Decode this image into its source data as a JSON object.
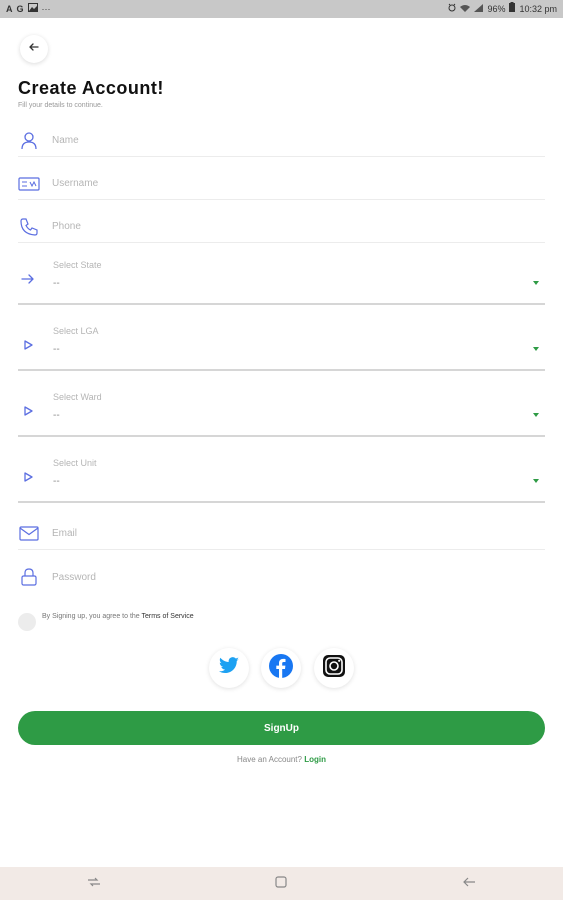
{
  "status_bar": {
    "left_icons": [
      "A",
      "G"
    ],
    "dots": "···",
    "battery": "96%",
    "time": "10:32 pm"
  },
  "header": {
    "title": "Create Account!",
    "subtitle": "Fill your details to continue."
  },
  "fields": {
    "name": "Name",
    "username": "Username",
    "phone": "Phone",
    "email": "Email",
    "password": "Password"
  },
  "selects": {
    "state": {
      "label": "Select State",
      "value": "--"
    },
    "lga": {
      "label": "Select LGA",
      "value": "--"
    },
    "ward": {
      "label": "Select Ward",
      "value": "--"
    },
    "unit": {
      "label": "Select Unit",
      "value": "--"
    }
  },
  "terms": {
    "prefix": "By Signing up, you agree to the ",
    "link": "Terms of Service"
  },
  "actions": {
    "signup": "SignUp",
    "have_account": "Have an Account? ",
    "login": "Login"
  },
  "colors": {
    "accent": "#2e9b45",
    "icon": "#5b6ee1",
    "twitter": "#1da1f2",
    "facebook": "#1877f2"
  },
  "icons": {
    "twitter": "twitter-icon",
    "facebook": "facebook-icon",
    "instagram": "instagram-icon"
  }
}
